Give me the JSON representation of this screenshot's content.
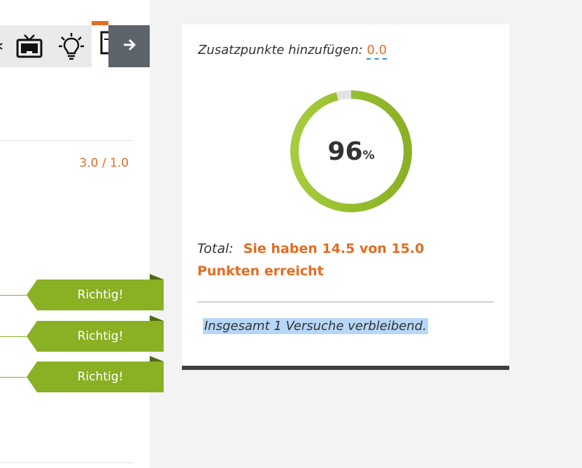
{
  "toolbar": {
    "icons": [
      "tv-icon",
      "lightbulb-icon",
      "document-icon"
    ],
    "next_icon": "arrow-right-icon"
  },
  "left": {
    "score_ratio": "3.0 / 1.0",
    "results": [
      {
        "label": "Richtig!"
      },
      {
        "label": "Richtig!"
      },
      {
        "label": "Richtig!"
      }
    ],
    "colors": {
      "correct": "#8ab024",
      "accent": "#e26d22"
    }
  },
  "card": {
    "extra_points_label": "Zusatzpunkte hinzufügen:",
    "extra_points_value": "0.0",
    "gauge": {
      "percent": 96,
      "value_text": "96",
      "unit": "%"
    },
    "total_label": "Total:",
    "total_message": "Sie haben 14.5 von 15.0 Punkten erreicht",
    "attempts_text": "Insgesamt 1 Versuche verbleibend."
  }
}
